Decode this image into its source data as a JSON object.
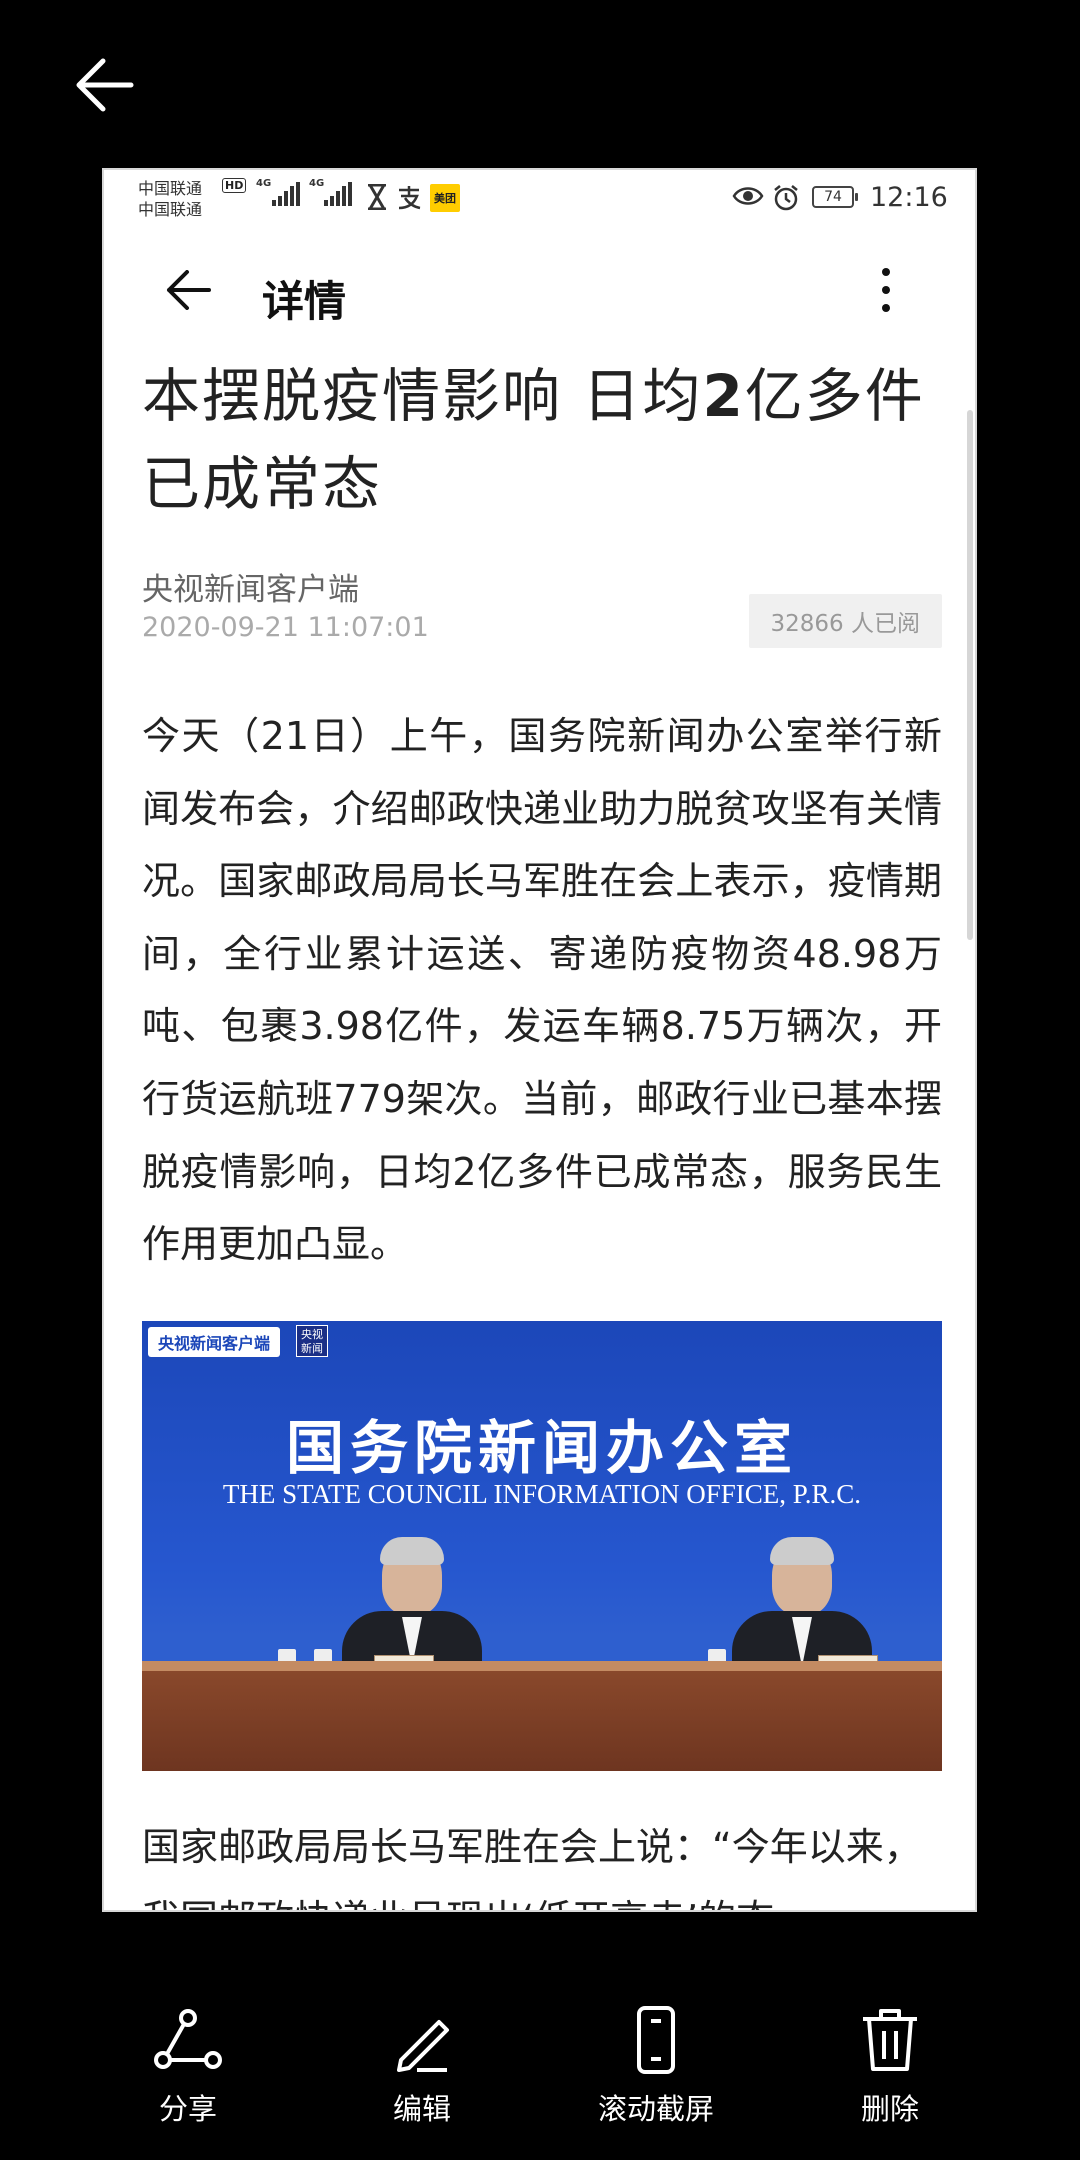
{
  "viewer": {
    "back_icon": "arrow-left-icon"
  },
  "status_bar": {
    "carrier_1": "中国联通",
    "carrier_2": "中国联通",
    "hd": "HD",
    "signal_1_label": "4G",
    "signal_2_label": "4G",
    "meituan_label": "美团",
    "battery": "74",
    "time": "12:16"
  },
  "header": {
    "title": "详情",
    "back_icon": "arrow-left-icon",
    "more_icon": "more-vertical-icon"
  },
  "article": {
    "title_part1": "本摆脱疫情影响 日均",
    "title_bold": "2",
    "title_part2": "亿多件已成常态",
    "source": "央视新闻客户端",
    "date": "2020-09-21 11:07:01",
    "views": "32866 人已阅",
    "paragraph_1": "今天（21日）上午，国务院新闻办公室举行新闻发布会，介绍邮政快递业助力脱贫攻坚有关情况。国家邮政局局长马军胜在会上表示，疫情期间，全行业累计运送、寄递防疫物资48.98万吨、包裹3.98亿件，发运车辆8.75万辆次，开行货运航班779架次。当前，邮政行业已基本摆脱疫情影响，日均2亿多件已成常态，服务民生作用更加凸显。",
    "image": {
      "tag": "央视新闻客户端",
      "logo": "央视新闻",
      "banner_cn": "国务院新闻办公室",
      "banner_en": "THE STATE COUNCIL INFORMATION OFFICE, P.R.C."
    },
    "paragraph_2": "国家邮政局局长马军胜在会上说：“今年以来，我国邮政快递业呈现出‘低开高走’的态"
  },
  "actions": [
    {
      "label": "分享",
      "icon": "share-icon"
    },
    {
      "label": "编辑",
      "icon": "edit-pencil-icon"
    },
    {
      "label": "滚动截屏",
      "icon": "scroll-screenshot-icon"
    },
    {
      "label": "删除",
      "icon": "trash-icon"
    }
  ]
}
